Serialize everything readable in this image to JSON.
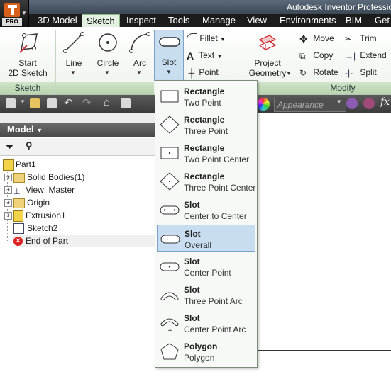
{
  "app": {
    "title": "Autodesk Inventor Professio",
    "badge": "PRO"
  },
  "menu_tabs": [
    {
      "label": "3D Model"
    },
    {
      "label": "Sketch"
    },
    {
      "label": "Inspect"
    },
    {
      "label": "Tools"
    },
    {
      "label": "Manage"
    },
    {
      "label": "View"
    },
    {
      "label": "Environments"
    },
    {
      "label": "BIM"
    },
    {
      "label": "Get S"
    }
  ],
  "ribbon": {
    "start_sketch": "Start\n2D Sketch",
    "line": "Line",
    "circle": "Circle",
    "arc": "Arc",
    "slot": "Slot",
    "fillet": "Fillet",
    "text": "Text",
    "point": "Point",
    "project_geometry": "Project\nGeometry",
    "move": "Move",
    "copy": "Copy",
    "rotate": "Rotate",
    "trim": "Trim",
    "extend": "Extend",
    "split": "Split",
    "groups": {
      "sketch": "Sketch",
      "modify": "Modify"
    }
  },
  "quick_access": {
    "appearance": "Appearance",
    "fx": "fx"
  },
  "browser": {
    "title": "Model",
    "tree": [
      {
        "label": "Part1"
      },
      {
        "label": "Solid Bodies(1)"
      },
      {
        "label": "View: Master"
      },
      {
        "label": "Origin"
      },
      {
        "label": "Extrusion1"
      },
      {
        "label": "Sketch2"
      },
      {
        "label": "End of Part"
      }
    ]
  },
  "dropdown": {
    "items": [
      {
        "title": "Rectangle",
        "sub": "Two Point",
        "icon": "rect-two-point-icon"
      },
      {
        "title": "Rectangle",
        "sub": "Three Point",
        "icon": "rect-three-point-icon"
      },
      {
        "title": "Rectangle",
        "sub": "Two Point Center",
        "icon": "rect-two-point-center-icon"
      },
      {
        "title": "Rectangle",
        "sub": "Three Point Center",
        "icon": "rect-three-point-center-icon"
      },
      {
        "title": "Slot",
        "sub": "Center to Center",
        "icon": "slot-center-to-center-icon"
      },
      {
        "title": "Slot",
        "sub": "Overall",
        "icon": "slot-overall-icon",
        "selected": true
      },
      {
        "title": "Slot",
        "sub": "Center Point",
        "icon": "slot-center-point-icon"
      },
      {
        "title": "Slot",
        "sub": "Three Point Arc",
        "icon": "slot-three-point-arc-icon"
      },
      {
        "title": "Slot",
        "sub": "Center Point Arc",
        "icon": "slot-center-point-arc-icon"
      },
      {
        "title": "Polygon",
        "sub": "Polygon",
        "icon": "polygon-icon"
      }
    ]
  },
  "colors": {
    "ribbon_active_tab": "#e4f0e2",
    "selection": "#c8ddf0",
    "group_label": "#cfe3c8"
  }
}
